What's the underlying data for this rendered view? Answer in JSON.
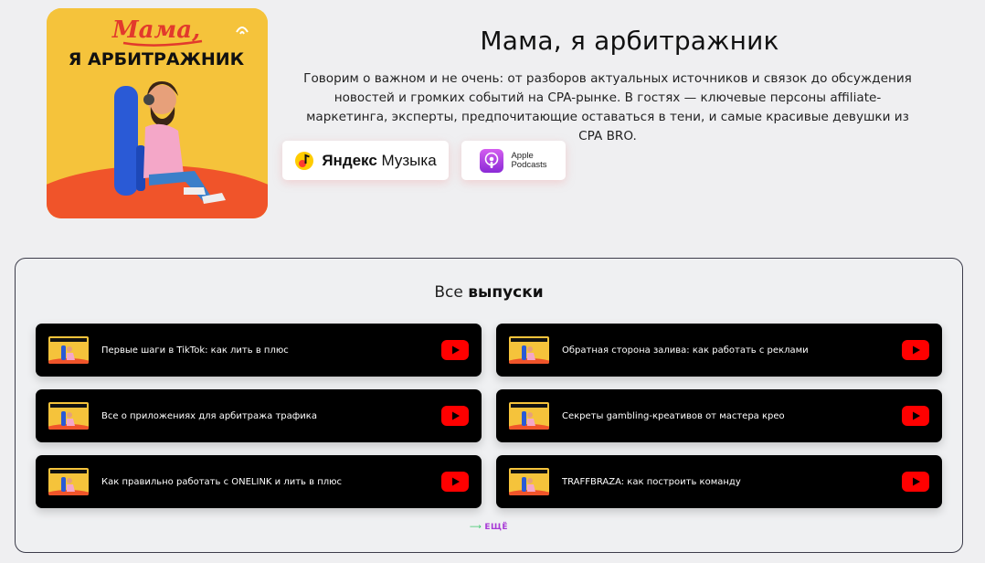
{
  "podcast": {
    "cover_line1": "Мама,",
    "cover_line2": "Я АРБИТРАЖНИК",
    "title": "Мама, я арбитражник",
    "description": "Говорим о важном и не очень: от разборов актуальных источников и связок до обсуждения новостей и громких событий на CPA-рынке. В гостях — ключевые персоны affiliate-маркетинга, эксперты, предпочитающие оставаться в тени, и самые красивые девушки из CPA BRO."
  },
  "platforms": {
    "yandex": {
      "label_bold": "Яндекс",
      "label_rest": " Музыка",
      "icon": "yandex-music-icon"
    },
    "apple": {
      "label_line1": "Apple",
      "label_line2": "Podcasts",
      "icon": "apple-podcasts-icon"
    }
  },
  "episodes": {
    "heading_prefix": "Все ",
    "heading_bold": "выпуски",
    "items": [
      {
        "title": "Первые шаги в TikTok: как лить в плюс"
      },
      {
        "title": "Обратная сторона залива: как работать с реклами"
      },
      {
        "title": "Все о приложениях для арбитража трафика"
      },
      {
        "title": "Секреты gambling-креативов от мастера крео"
      },
      {
        "title": "Как правильно работать с ONELINK и лить в плюс"
      },
      {
        "title": "TRAFFBRAZA: как построить команду"
      }
    ],
    "more_label": "ЕЩЁ"
  },
  "colors": {
    "background": "#efeff1",
    "card": "#000000",
    "youtube_red": "#ff0000",
    "more_purple": "#a83bd6",
    "more_arrow_green": "#3ec86b",
    "cover_yellow": "#f5c33b",
    "cover_orange": "#f0542a"
  }
}
